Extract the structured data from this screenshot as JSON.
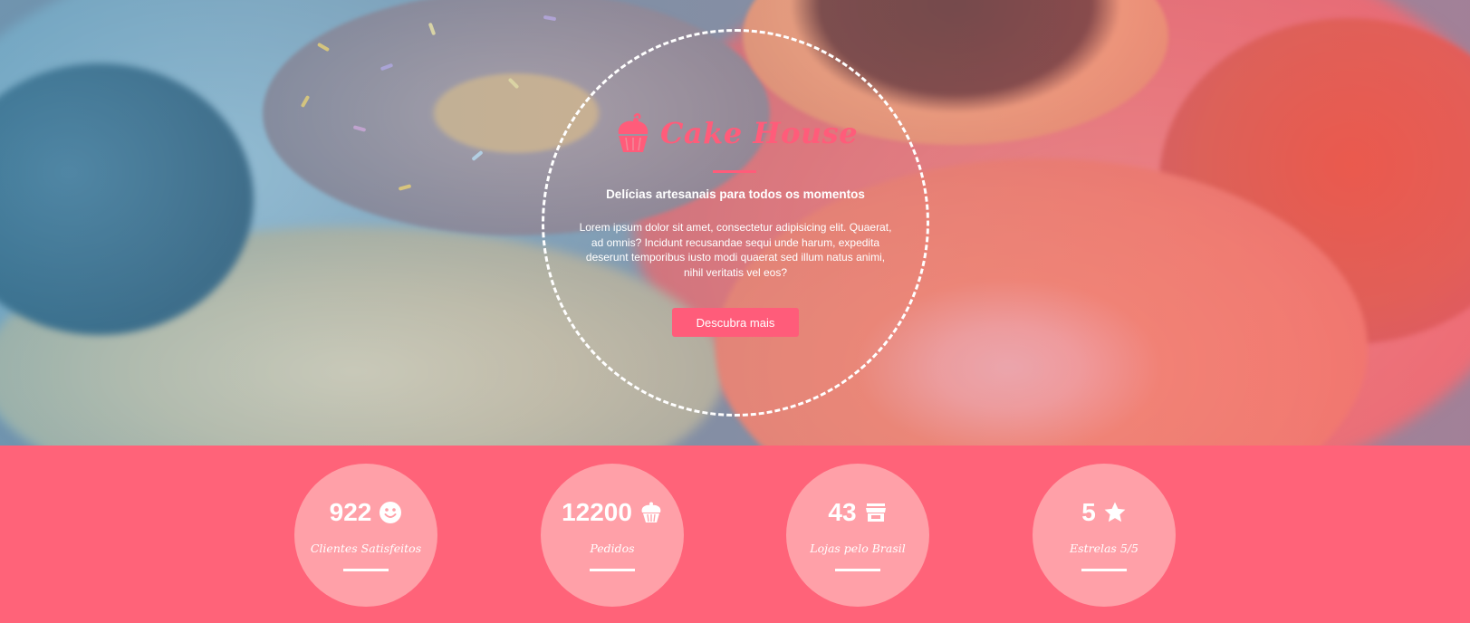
{
  "hero": {
    "brand_name": "Cake House",
    "tagline": "Delícias artesanais para todos os momentos",
    "description": "Lorem ipsum dolor sit amet, consectetur adipisicing elit. Quaerat, ad omnis? Incidunt recusandae sequi unde harum, expedita deserunt temporibus iusto modi quaerat sed illum natus animi, nihil veritatis vel eos?",
    "cta_label": "Descubra mais"
  },
  "stats": [
    {
      "value": "922",
      "label": "Clientes Satisfeitos",
      "icon": "smiley-icon"
    },
    {
      "value": "12200",
      "label": "Pedidos",
      "icon": "cupcake-icon"
    },
    {
      "value": "43",
      "label": "Lojas pelo Brasil",
      "icon": "store-icon"
    },
    {
      "value": "5",
      "label": "Estrelas 5/5",
      "icon": "star-icon"
    }
  ],
  "colors": {
    "accent": "#ff5c7a",
    "stats_background": "#ff6379",
    "stat_circle": "#ffa0a8",
    "text": "#ffffff"
  }
}
